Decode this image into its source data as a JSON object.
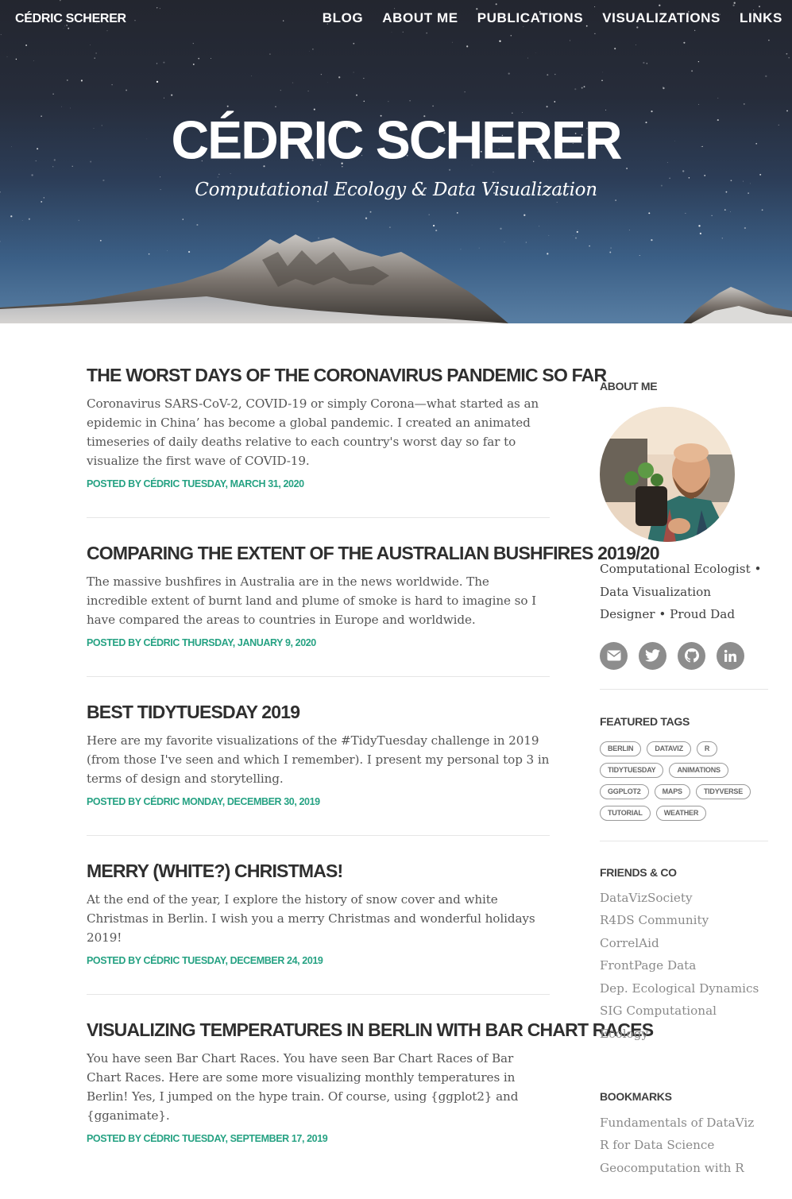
{
  "nav": {
    "brand": "Cédric Scherer",
    "links": [
      "Blog",
      "About Me",
      "Publications",
      "Visualizations",
      "Links"
    ]
  },
  "hero": {
    "title": "Cédric Scherer",
    "subtitle": "Computational Ecology & Data Visualization"
  },
  "posts": [
    {
      "title": "The worst days of the coronavirus pandemic so far",
      "excerpt": "Coronavirus SARS-CoV-2, COVID-19 or simply Corona—what started as an epidemic in China’ has become a global pandemic. I created an animated timeseries of daily deaths relative to each country's worst day so far to visualize the first wave of COVID-19.",
      "meta": "Posted by Cédric Tuesday, March 31, 2020"
    },
    {
      "title": "Comparing the extent of the Australian bushfires 2019/20",
      "excerpt": "The massive bushfires in Australia are in the news worldwide. The incredible extent of burnt land and plume of smoke is hard to imagine so I have compared the areas to countries in Europe and worldwide.",
      "meta": "Posted by Cédric Thursday, January 9, 2020"
    },
    {
      "title": "Best TidyTuesday 2019",
      "excerpt": "Here are my favorite visualizations of the #TidyTuesday challenge in 2019 (from those I've seen and which I remember). I present my personal top 3 in terms of design and storytelling.",
      "meta": "Posted by Cédric Monday, December 30, 2019"
    },
    {
      "title": "Merry (White?) Christmas!",
      "excerpt": "At the end of the year, I explore the history of snow cover and white Christmas in Berlin. I wish you a merry Christmas and wonderful holidays 2019!",
      "meta": "Posted by Cédric Tuesday, December 24, 2019"
    },
    {
      "title": "Visualizing temperatures in Berlin with bar chart races",
      "excerpt": "You have seen Bar Chart Races. You have seen Bar Chart Races of Bar Chart Races. Here are some more visualizing monthly temperatures in Berlin! Yes, I jumped on the hype train. Of course, using {ggplot2} and {gganimate}.",
      "meta": "Posted by Cédric Tuesday, September 17, 2019"
    }
  ],
  "sidebar": {
    "about_heading": "About Me",
    "about_text": "Computational Ecologist • Data Visualization Designer • Proud Dad",
    "social_icons": [
      "envelope-icon",
      "twitter-icon",
      "github-icon",
      "linkedin-icon"
    ],
    "tags_heading": "Featured Tags",
    "tags": [
      "berlin",
      "dataviz",
      "R",
      "tidytuesday",
      "animations",
      "ggplot2",
      "maps",
      "tidyverse",
      "tutorial",
      "weather"
    ],
    "friends_heading": "Friends & Co",
    "friends": [
      "DataVizSociety",
      "R4DS Community",
      "CorrelAid",
      "FrontPage Data",
      "Dep. Ecological Dynamics",
      "SIG Computational Ecology"
    ],
    "bookmarks_heading": "Bookmarks",
    "bookmarks": [
      "Fundamentals of DataViz",
      "R for Data Science",
      "Geocomputation with R"
    ]
  },
  "colors": {
    "accent_green": "#26a283",
    "social_gray": "#8d8d8d",
    "link_gray": "#8a8a8a"
  }
}
